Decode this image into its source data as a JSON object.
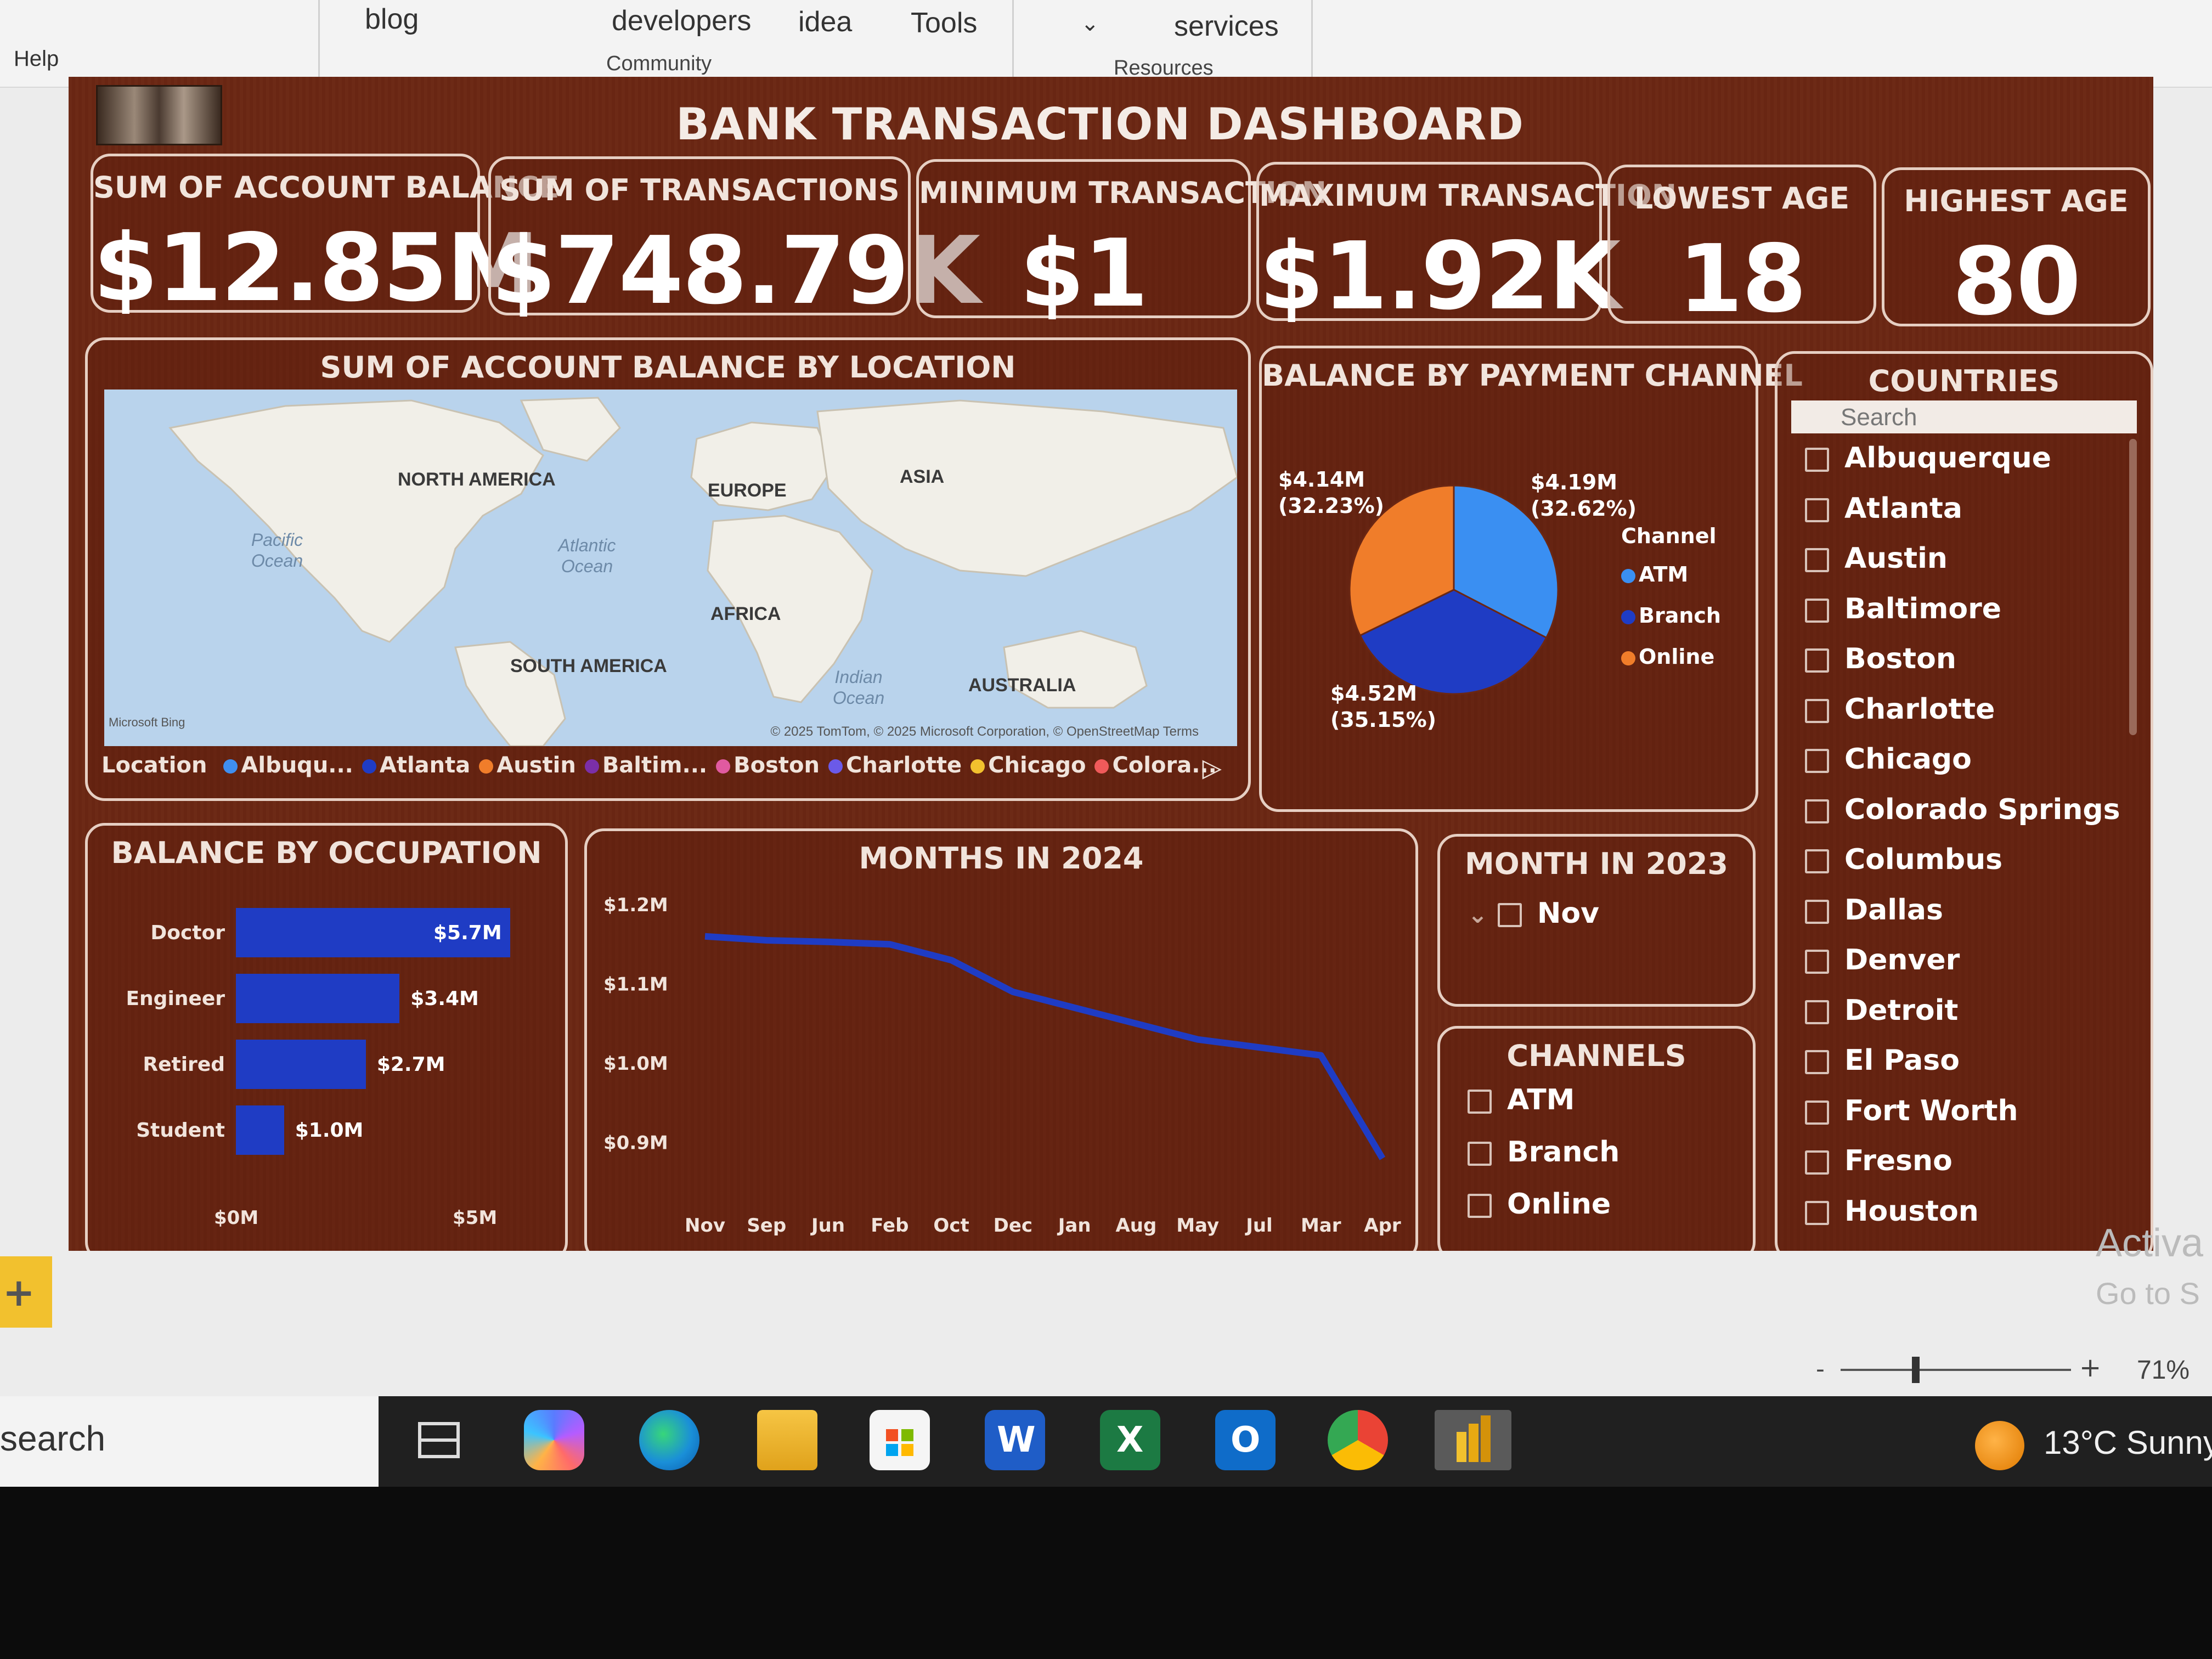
{
  "ribbon": {
    "help": "Help",
    "blog": "blog",
    "developers": "developers",
    "idea": "idea",
    "tools": "Tools",
    "services": "services",
    "community": "Community",
    "resources": "Resources"
  },
  "dashboard": {
    "title": "BANK TRANSACTION DASHBOARD",
    "kpis": [
      {
        "label": "SUM OF ACCOUNT  BALANCE",
        "value": "$12.85M"
      },
      {
        "label": "SUM OF TRANSACTIONS",
        "value": "$748.79K"
      },
      {
        "label": "MINIMUM TRANSACTION",
        "value": "$1"
      },
      {
        "label": "MAXIMUM TRANSACTION",
        "value": "$1.92K"
      },
      {
        "label": "LOWEST AGE",
        "value": "18"
      },
      {
        "label": "HIGHEST AGE",
        "value": "80"
      }
    ],
    "map": {
      "title": "SUM OF ACCOUNT BALANCE BY LOCATION",
      "continents": [
        "NORTH AMERICA",
        "EUROPE",
        "ASIA",
        "AFRICA",
        "SOUTH AMERICA",
        "AUSTRALIA"
      ],
      "oceans": [
        "Pacific Ocean",
        "Atlantic Ocean",
        "Indian Ocean"
      ],
      "copyright": "© 2025 TomTom, © 2025 Microsoft Corporation, © OpenStreetMap  Terms",
      "brand": "Microsoft Bing",
      "legend_title": "Location",
      "legend": [
        {
          "label": "Albuqu...",
          "color": "#3f8ff0"
        },
        {
          "label": "Atlanta",
          "color": "#1f3cc4"
        },
        {
          "label": "Austin",
          "color": "#f07d2a"
        },
        {
          "label": "Baltim...",
          "color": "#7b2fa8"
        },
        {
          "label": "Boston",
          "color": "#e05aa0"
        },
        {
          "label": "Charlotte",
          "color": "#6b5ae8"
        },
        {
          "label": "Chicago",
          "color": "#f2c12e"
        },
        {
          "label": "Colora...",
          "color": "#ef5a5a"
        }
      ]
    },
    "payment_channel": {
      "title": "BALANCE BY PAYMENT CHANNEL",
      "legend_title": "Channel",
      "label_online": "$4.14M\n(32.23%)",
      "label_atm": "$4.19M\n(32.62%)",
      "label_branch": "$4.52M\n(35.15%)",
      "channels": [
        {
          "name": "ATM",
          "color": "#3a8ff2"
        },
        {
          "name": "Branch",
          "color": "#1f3cc4"
        },
        {
          "name": "Online",
          "color": "#f07d2a"
        }
      ]
    },
    "countries": {
      "title": "COUNTRIES",
      "search_placeholder": "Search",
      "items": [
        "Albuquerque",
        "Atlanta",
        "Austin",
        "Baltimore",
        "Boston",
        "Charlotte",
        "Chicago",
        "Colorado Springs",
        "Columbus",
        "Dallas",
        "Denver",
        "Detroit",
        "El Paso",
        "Fort Worth",
        "Fresno",
        "Houston"
      ]
    },
    "occupation": {
      "title": "BALANCE BY OCCUPATION",
      "x_ticks": [
        "$0M",
        "$5M"
      ]
    },
    "months_2024": {
      "title": "MONTHS IN 2024",
      "y_ticks": [
        "$1.2M",
        "$1.1M",
        "$1.0M",
        "$0.9M"
      ]
    },
    "month_2023": {
      "title": "MONTH IN 2023",
      "item": "Nov"
    },
    "channels_slicer": {
      "title": "CHANNELS",
      "items": [
        "ATM",
        "Branch",
        "Online"
      ]
    }
  },
  "chart_data": [
    {
      "type": "pie",
      "title": "BALANCE BY PAYMENT CHANNEL",
      "categories": [
        "ATM",
        "Branch",
        "Online"
      ],
      "values": [
        4.19,
        4.52,
        4.14
      ],
      "percentages": [
        32.62,
        35.15,
        32.23
      ],
      "legend_placement": "right"
    },
    {
      "type": "bar",
      "orientation": "horizontal",
      "title": "BALANCE BY OCCUPATION",
      "categories": [
        "Doctor",
        "Engineer",
        "Retired",
        "Student"
      ],
      "values": [
        5.7,
        3.4,
        2.7,
        1.0
      ],
      "value_labels": [
        "$5.7M",
        "$3.4M",
        "$2.7M",
        "$1.0M"
      ],
      "xlim": [
        0,
        5.7
      ]
    },
    {
      "type": "line",
      "title": "MONTHS IN 2024",
      "x": [
        "Nov",
        "Sep",
        "Jun",
        "Feb",
        "Oct",
        "Dec",
        "Jan",
        "Aug",
        "May",
        "Jul",
        "Mar",
        "Apr"
      ],
      "values": [
        1.16,
        1.155,
        1.153,
        1.15,
        1.13,
        1.09,
        1.07,
        1.05,
        1.03,
        1.02,
        1.01,
        0.88
      ],
      "ylim": [
        0.85,
        1.22
      ]
    }
  ],
  "ui": {
    "zoom": "71%",
    "activate_line1": "Activa",
    "activate_line2": "Go to S",
    "search": "search",
    "weather": "13°C  Sunny"
  }
}
